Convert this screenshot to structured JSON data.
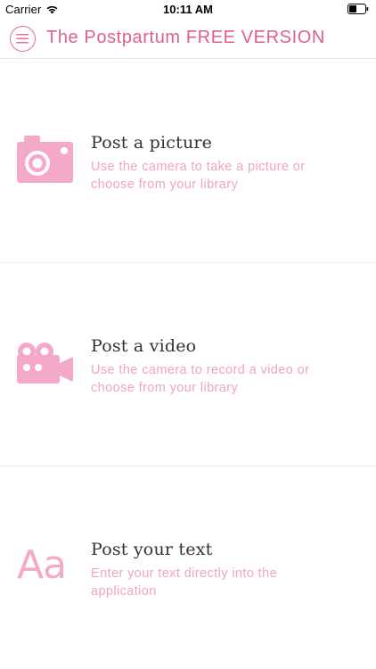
{
  "status_bar": {
    "carrier": "Carrier",
    "time": "10:11 AM",
    "wifi_icon": "wifi-icon",
    "battery_icon": "battery-icon"
  },
  "nav": {
    "menu_icon": "hamburger-menu-icon",
    "title": "The Postpartum FREE VERSION"
  },
  "options": [
    {
      "title": "Post a picture",
      "description": "Use the camera to take a picture or choose from your library",
      "icon": "camera-icon"
    },
    {
      "title": "Post a video",
      "description": "Use the camera to record a video or choose from your library",
      "icon": "video-camera-icon"
    },
    {
      "title": "Post your text",
      "description": "Enter your text directly into the application",
      "icon_text": "Aa"
    }
  ],
  "colors": {
    "accent": "#dd5e90",
    "icon_pink": "#f5a9c8",
    "description_pink": "#f2a3c4",
    "title_text": "#333333"
  }
}
